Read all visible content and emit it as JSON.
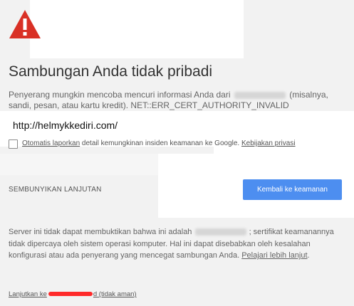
{
  "page": {
    "title": "Sambungan Anda tidak pribadi",
    "description_part1": "Penyerang mungkin mencoba mencuri informasi Anda dari",
    "description_part2": "(misalnya, sandi, pesan, atau kartu kredit). NET::ERR_CERT_AUTHORITY_INVALID",
    "url_overlay": "http://helmykkediri.com/",
    "report_label_link": "Otomatis laporkan",
    "report_label_text": " detail kemungkinan insiden keamanan ke Google. ",
    "privacy_link": "Kebijakan privasi",
    "hide_advanced_label": "SEMBUNYIKAN LANJUTAN",
    "back_button_label": "Kembali ke keamanan",
    "advanced_part1": "Server ini tidak dapat membuktikan bahwa ini adalah",
    "advanced_part2": "; sertifikat keamanannya tidak dipercaya oleh sistem operasi komputer. Hal ini dapat disebabkan oleh kesalahan konfigurasi atau ada penyerang yang mencegat sambungan Anda.",
    "learn_more_link": "Pelajari lebih lanjut",
    "learn_more_suffix": ".",
    "proceed_prefix": "Lanjutkan ke",
    "proceed_suffix": "d (tidak aman)"
  },
  "colors": {
    "background": "#f2f2f2",
    "warning_red": "#d93025",
    "button_blue": "#4d8ef0",
    "redaction_red": "#ff2a2a"
  },
  "icons": {
    "warning": "warning-triangle-icon",
    "checkbox": "checkbox-unchecked"
  }
}
